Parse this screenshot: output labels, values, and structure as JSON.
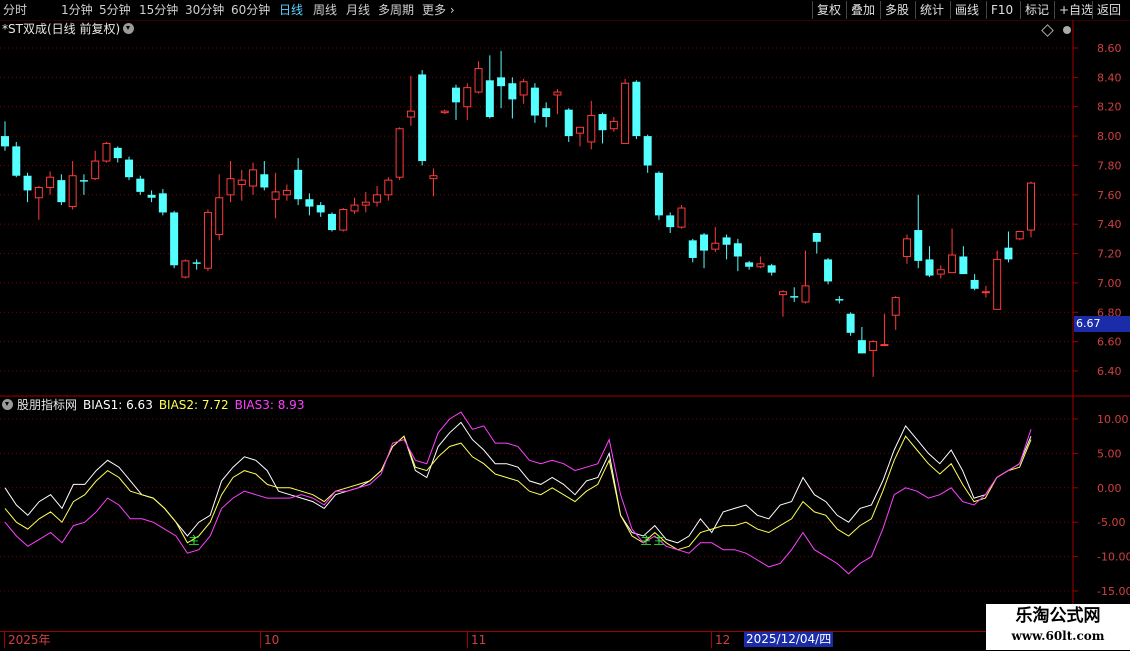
{
  "toolbar": {
    "periods": [
      "分时",
      "1分钟",
      "5分钟",
      "15分钟",
      "30分钟",
      "60分钟",
      "日线",
      "周线",
      "月线",
      "多周期",
      "更多"
    ],
    "active_period": "日线",
    "buttons": [
      "复权",
      "叠加",
      "多股",
      "统计",
      "画线",
      "F10",
      "标记",
      "+自选",
      "返回"
    ]
  },
  "price_panel": {
    "title": "*ST双成(日线 前复权)",
    "y_ticks": [
      "8.60",
      "8.40",
      "8.20",
      "8.00",
      "7.80",
      "7.60",
      "7.40",
      "7.20",
      "7.00",
      "6.80",
      "6.60",
      "6.40"
    ],
    "current_price": "6.67"
  },
  "indicator_panel": {
    "name": "股朋指标网",
    "bias1_label": "BIAS1: 6.63",
    "bias2_label": "BIAS2: 7.72",
    "bias3_label": "BIAS3: 8.93",
    "y_ticks": [
      "10.00",
      "5.00",
      "0.00",
      "-5.00",
      "-10.00",
      "-15.00"
    ],
    "markers": [
      "主",
      "主",
      "主"
    ]
  },
  "time_axis": {
    "labels": [
      "2025年",
      "10",
      "11",
      "12"
    ],
    "cursor_date": "2025/12/04/四"
  },
  "watermark": {
    "title": "乐淘公式网",
    "url": "www.60lt.com"
  },
  "colors": {
    "up": "#ff3b3b",
    "down": "#54ffff",
    "bias1": "#ffffff",
    "bias2": "#ffff55",
    "bias3": "#ff40ff",
    "grid": "#7a0000",
    "axis_text": "#d04040"
  },
  "chart_data": [
    {
      "type": "candlestick",
      "title": "*ST双成(日线 前复权)",
      "ylim": [
        6.3,
        8.7
      ],
      "candles": [
        [
          8.0,
          7.93,
          8.1,
          7.9
        ],
        [
          7.93,
          7.73,
          7.96,
          7.72
        ],
        [
          7.73,
          7.63,
          7.75,
          7.55
        ],
        [
          7.58,
          7.65,
          7.66,
          7.43
        ],
        [
          7.65,
          7.72,
          7.76,
          7.6
        ],
        [
          7.7,
          7.55,
          7.74,
          7.53
        ],
        [
          7.52,
          7.73,
          7.83,
          7.5
        ],
        [
          7.7,
          7.69,
          7.74,
          7.6
        ],
        [
          7.71,
          7.83,
          7.9,
          7.7
        ],
        [
          7.83,
          7.95,
          7.96,
          7.82
        ],
        [
          7.92,
          7.85,
          7.93,
          7.82
        ],
        [
          7.84,
          7.72,
          7.86,
          7.7
        ],
        [
          7.71,
          7.62,
          7.73,
          7.6
        ],
        [
          7.6,
          7.58,
          7.63,
          7.55
        ],
        [
          7.61,
          7.48,
          7.64,
          7.46
        ],
        [
          7.48,
          7.12,
          7.49,
          7.1
        ],
        [
          7.04,
          7.15,
          7.16,
          7.03
        ],
        [
          7.14,
          7.13,
          7.16,
          7.09
        ],
        [
          7.1,
          7.48,
          7.5,
          7.08
        ],
        [
          7.33,
          7.58,
          7.74,
          7.29
        ],
        [
          7.6,
          7.71,
          7.83,
          7.55
        ],
        [
          7.67,
          7.7,
          7.77,
          7.56
        ],
        [
          7.66,
          7.77,
          7.82,
          7.6
        ],
        [
          7.74,
          7.65,
          7.83,
          7.63
        ],
        [
          7.57,
          7.62,
          7.75,
          7.44
        ],
        [
          7.6,
          7.63,
          7.67,
          7.56
        ],
        [
          7.77,
          7.57,
          7.85,
          7.53
        ],
        [
          7.57,
          7.52,
          7.61,
          7.46
        ],
        [
          7.53,
          7.48,
          7.55,
          7.45
        ],
        [
          7.47,
          7.36,
          7.48,
          7.35
        ],
        [
          7.36,
          7.5,
          7.51,
          7.35
        ],
        [
          7.49,
          7.53,
          7.58,
          7.47
        ],
        [
          7.53,
          7.55,
          7.62,
          7.48
        ],
        [
          7.55,
          7.6,
          7.66,
          7.52
        ],
        [
          7.6,
          7.7,
          7.72,
          7.56
        ],
        [
          7.72,
          8.05,
          8.06,
          7.7
        ],
        [
          8.13,
          8.17,
          8.41,
          8.07
        ],
        [
          8.42,
          7.83,
          8.45,
          7.8
        ],
        [
          7.71,
          7.73,
          7.78,
          7.59
        ],
        [
          8.16,
          8.17,
          8.18,
          8.15
        ],
        [
          8.33,
          8.23,
          8.35,
          8.11
        ],
        [
          8.2,
          8.33,
          8.36,
          8.11
        ],
        [
          8.3,
          8.46,
          8.51,
          8.29
        ],
        [
          8.38,
          8.13,
          8.55,
          8.12
        ],
        [
          8.4,
          8.34,
          8.58,
          8.19
        ],
        [
          8.36,
          8.25,
          8.4,
          8.12
        ],
        [
          8.28,
          8.37,
          8.39,
          8.22
        ],
        [
          8.33,
          8.14,
          8.36,
          8.09
        ],
        [
          8.19,
          8.13,
          8.23,
          8.06
        ],
        [
          8.28,
          8.3,
          8.32,
          8.15
        ],
        [
          8.18,
          8.0,
          8.19,
          7.96
        ],
        [
          8.02,
          8.06,
          8.05,
          7.93
        ],
        [
          7.96,
          8.14,
          8.24,
          7.91
        ],
        [
          8.15,
          8.04,
          8.16,
          7.95
        ],
        [
          8.05,
          8.1,
          8.13,
          8.03
        ],
        [
          7.95,
          8.36,
          8.39,
          7.96
        ],
        [
          8.37,
          8.0,
          8.38,
          7.98
        ],
        [
          8.0,
          7.8,
          8.01,
          7.75
        ],
        [
          7.75,
          7.46,
          7.76,
          7.43
        ],
        [
          7.46,
          7.38,
          7.48,
          7.34
        ],
        [
          7.38,
          7.51,
          7.53,
          7.37
        ],
        [
          7.29,
          7.17,
          7.3,
          7.14
        ],
        [
          7.33,
          7.22,
          7.34,
          7.1
        ],
        [
          7.23,
          7.27,
          7.38,
          7.21
        ],
        [
          7.31,
          7.26,
          7.33,
          7.16
        ],
        [
          7.27,
          7.18,
          7.3,
          7.08
        ],
        [
          7.14,
          7.11,
          7.15,
          7.09
        ],
        [
          7.11,
          7.13,
          7.18,
          7.1
        ],
        [
          7.12,
          7.07,
          7.13,
          7.05
        ],
        [
          6.92,
          6.94,
          6.95,
          6.77
        ],
        [
          6.91,
          6.9,
          6.97,
          6.87
        ],
        [
          6.87,
          6.98,
          7.22,
          6.86
        ],
        [
          7.34,
          7.28,
          7.34,
          7.2
        ],
        [
          7.16,
          7.01,
          7.17,
          6.99
        ],
        [
          6.89,
          6.88,
          6.91,
          6.86
        ],
        [
          6.79,
          6.66,
          6.8,
          6.64
        ],
        [
          6.61,
          6.52,
          6.7,
          6.52
        ],
        [
          6.54,
          6.6,
          6.61,
          6.36
        ],
        [
          6.58,
          6.58,
          6.79,
          6.57
        ],
        [
          6.78,
          6.9,
          6.91,
          6.68
        ],
        [
          7.18,
          7.3,
          7.33,
          7.13
        ],
        [
          7.36,
          7.15,
          7.6,
          7.1
        ],
        [
          7.16,
          7.05,
          7.25,
          7.04
        ],
        [
          7.06,
          7.09,
          7.12,
          7.03
        ],
        [
          7.07,
          7.19,
          7.37,
          7.07
        ],
        [
          7.18,
          7.06,
          7.25,
          7.07
        ],
        [
          7.02,
          6.96,
          7.06,
          6.95
        ],
        [
          6.94,
          6.94,
          6.98,
          6.9
        ],
        [
          6.82,
          7.16,
          7.22,
          6.82
        ],
        [
          7.24,
          7.16,
          7.35,
          7.14
        ],
        [
          7.3,
          7.35,
          7.35,
          7.29
        ],
        [
          7.36,
          7.68,
          7.69,
          7.31
        ]
      ]
    },
    {
      "type": "line",
      "title": "股朋指标网",
      "ylim": [
        -15,
        12
      ],
      "series": [
        {
          "name": "BIAS1",
          "values": [
            0.0,
            -2.5,
            -4.0,
            -2.0,
            -1.0,
            -3.0,
            0.5,
            0.5,
            2.5,
            4.0,
            3.0,
            1.0,
            -1.0,
            -1.5,
            -3.0,
            -5.0,
            -7.0,
            -5.0,
            -4.0,
            1.0,
            3.0,
            4.5,
            4.0,
            2.5,
            -0.5,
            -1.0,
            -1.5,
            -2.0,
            -3.0,
            -1.0,
            -0.5,
            0.0,
            1.0,
            2.5,
            6.0,
            7.5,
            2.5,
            1.5,
            6.0,
            8.0,
            9.5,
            7.0,
            5.5,
            3.5,
            3.5,
            3.0,
            1.0,
            0.5,
            1.5,
            0.5,
            -1.0,
            1.0,
            1.5,
            5.0,
            -4.0,
            -6.5,
            -7.0,
            -5.5,
            -7.5,
            -8.0,
            -7.0,
            -4.5,
            -6.5,
            -3.5,
            -3.0,
            -2.5,
            -4.0,
            -4.5,
            -2.5,
            -2.0,
            1.5,
            -1.0,
            -2.0,
            -4.0,
            -5.0,
            -3.0,
            -2.5,
            1.0,
            5.5,
            9.0,
            7.0,
            5.0,
            3.5,
            5.5,
            2.5,
            -1.5,
            -1.0,
            1.5,
            2.5,
            3.5,
            7.5
          ]
        },
        {
          "name": "BIAS2",
          "values": [
            -3.0,
            -5.0,
            -6.0,
            -4.5,
            -3.5,
            -5.0,
            -2.0,
            -1.0,
            1.0,
            2.5,
            1.5,
            -0.5,
            -1.0,
            -1.5,
            -3.0,
            -5.0,
            -8.0,
            -7.0,
            -5.0,
            -1.0,
            1.5,
            2.5,
            2.0,
            0.5,
            0.0,
            0.0,
            -0.5,
            -1.0,
            -2.0,
            -0.5,
            0.0,
            0.5,
            1.0,
            2.5,
            6.0,
            7.5,
            3.0,
            2.5,
            4.5,
            6.0,
            6.5,
            4.5,
            3.5,
            2.0,
            1.5,
            1.0,
            -0.5,
            -1.0,
            0.0,
            -1.0,
            -2.0,
            -0.5,
            0.5,
            4.0,
            -4.0,
            -7.0,
            -8.0,
            -6.5,
            -8.0,
            -9.0,
            -8.5,
            -6.5,
            -6.0,
            -5.5,
            -5.5,
            -5.0,
            -6.0,
            -6.5,
            -5.5,
            -4.5,
            -2.0,
            -3.5,
            -4.0,
            -6.0,
            -7.0,
            -5.5,
            -4.5,
            -0.5,
            4.0,
            7.5,
            5.5,
            3.5,
            2.0,
            3.5,
            0.5,
            -2.0,
            -1.5,
            1.5,
            2.5,
            3.0,
            7.0
          ]
        },
        {
          "name": "BIAS3",
          "values": [
            -5.0,
            -7.0,
            -8.5,
            -7.5,
            -6.5,
            -8.0,
            -5.5,
            -5.0,
            -3.5,
            -1.5,
            -2.5,
            -4.5,
            -4.5,
            -5.0,
            -6.0,
            -7.0,
            -9.5,
            -9.0,
            -7.0,
            -3.0,
            -1.5,
            -0.5,
            -1.0,
            -1.5,
            -1.5,
            -1.5,
            -1.0,
            -1.5,
            -2.5,
            -0.5,
            -0.5,
            0.0,
            0.5,
            2.0,
            6.5,
            7.0,
            4.0,
            3.5,
            8.0,
            10.0,
            11.0,
            8.5,
            9.0,
            6.5,
            6.5,
            6.0,
            4.0,
            3.5,
            4.0,
            3.5,
            2.5,
            3.0,
            3.5,
            7.0,
            -1.0,
            -6.0,
            -8.0,
            -7.0,
            -8.5,
            -9.0,
            -9.5,
            -8.0,
            -8.0,
            -9.0,
            -9.0,
            -9.5,
            -10.5,
            -11.5,
            -11.0,
            -9.0,
            -6.5,
            -9.0,
            -10.0,
            -11.0,
            -12.5,
            -11.0,
            -10.0,
            -6.0,
            -1.0,
            0.0,
            -0.5,
            -1.5,
            -1.0,
            0.0,
            -2.0,
            -2.5,
            -1.0,
            1.5,
            2.5,
            3.5,
            8.5
          ]
        }
      ]
    }
  ]
}
